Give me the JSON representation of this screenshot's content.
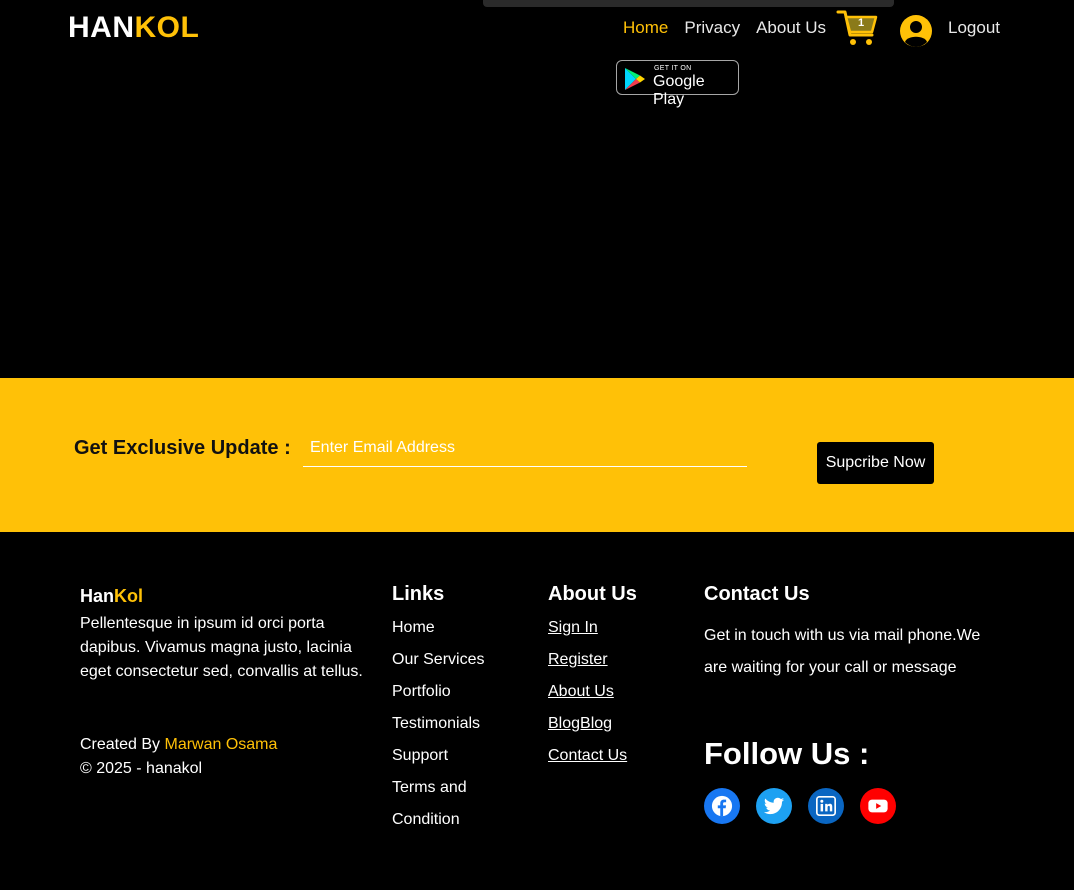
{
  "header": {
    "logo_part1": "HAN",
    "logo_part2": "KOL",
    "nav": [
      "Home",
      "Privacy",
      "About Us"
    ],
    "cart_count": "1",
    "logout": "Logout",
    "google_play_small": "GET IT ON",
    "google_play_big": "Google Play"
  },
  "newsletter": {
    "title": "Get Exclusive Update :",
    "email_placeholder": "Enter Email Address",
    "button": "Supcribe Now"
  },
  "footer": {
    "brand_part1": "Han",
    "brand_part2": "Kol",
    "about_text": "Pellentesque in ipsum id orci porta dapibus. Vivamus magna justo, lacinia eget consectetur sed, convallis at tellus.",
    "created_by": "Created By ",
    "author": "Marwan Osama",
    "copyright": "© 2025 - hanakol",
    "links_title": "Links",
    "links": [
      "Home",
      "Our Services",
      "Portfolio",
      "Testimonials",
      "Support",
      "Terms and",
      "Condition"
    ],
    "about_title": "About Us",
    "about_links": [
      "Sign In",
      "Register",
      "About Us",
      "BlogBlog",
      "Contact Us"
    ],
    "contact_title": "Contact Us",
    "contact_text": "Get in touch with us via mail phone.We are waiting for your call or message",
    "follow_title": "Follow Us :",
    "socials": [
      "facebook-icon",
      "twitter-icon",
      "linkedin-icon",
      "youtube-icon"
    ]
  },
  "colors": {
    "accent": "#ffc107",
    "background": "#000000",
    "facebook": "#1877f2",
    "twitter": "#1da1f2",
    "linkedin": "#0a66c2",
    "youtube": "#ff0000"
  }
}
